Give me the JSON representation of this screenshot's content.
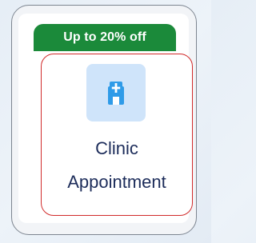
{
  "card": {
    "offer_badge": "Up to 20% off",
    "icon": "clinic-building-icon",
    "title_line1": "Clinic",
    "title_line2": "Appointment"
  },
  "colors": {
    "badge_green": "#1b8a3a",
    "highlight_red": "#d12a2a",
    "icon_blue": "#2f9be8",
    "icon_tile_bg": "#cfe4fa",
    "title_navy": "#1c2c5a"
  }
}
